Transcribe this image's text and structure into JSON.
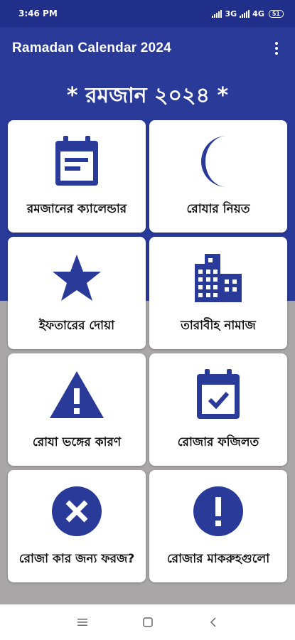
{
  "status_bar": {
    "time": "3:46 PM",
    "network_1": "3G",
    "network_2": "4G",
    "battery": "51"
  },
  "app_bar": {
    "title": "Ramadan Calendar 2024",
    "menu_icon": "more-vert-icon"
  },
  "heading": "* রমজান ২০২৪ *",
  "cards": [
    {
      "label": "রমজানের ক্যালেন্ডার",
      "icon": "calendar-icon"
    },
    {
      "label": "রোযার নিয়ত",
      "icon": "crescent-moon-icon"
    },
    {
      "label": "ইফতারের দোয়া",
      "icon": "star-icon"
    },
    {
      "label": "তারাবীহ নামাজ",
      "icon": "building-icon"
    },
    {
      "label": "রোযা ভঙ্গের কারণ",
      "icon": "warning-icon"
    },
    {
      "label": "রোজার ফজিলত",
      "icon": "event-available-icon"
    },
    {
      "label": "রোজা কার জন্য ফরজ?",
      "icon": "cancel-icon"
    },
    {
      "label": "রোজার মাকরুহগুলো",
      "icon": "exclamation-icon"
    }
  ],
  "colors": {
    "primary": "#2a3a99",
    "status_bar": "#1f2f8a",
    "icon": "#2a3a99",
    "lower_background": "#a9a7a7"
  },
  "nav_bar": {
    "recents_icon": "menu-icon",
    "home_icon": "square-icon",
    "back_icon": "back-chevron-icon"
  }
}
